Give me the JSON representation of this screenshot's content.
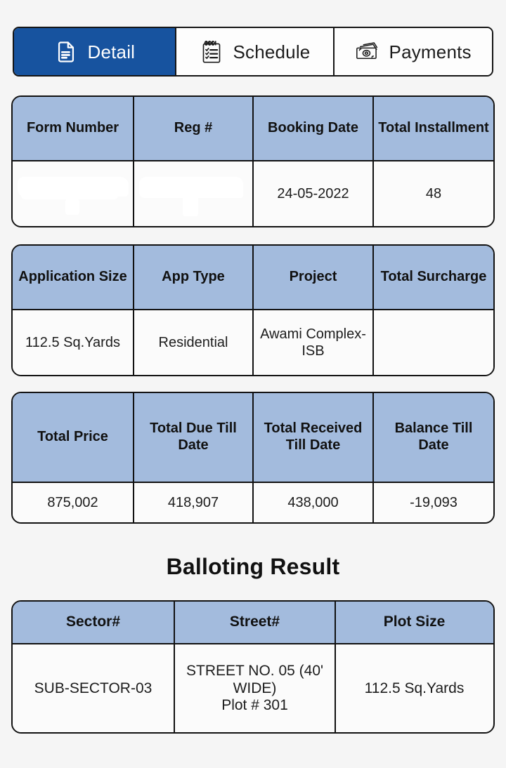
{
  "theme": {
    "page_background": "#f5f5f5",
    "active_tab_color": "#17539f",
    "table_header_color": "#a3bbdd",
    "border_color": "#111111",
    "text_color": "#1c1c1c"
  },
  "tabs": [
    {
      "id": "detail",
      "label": "Detail",
      "icon": "document-icon",
      "active": true
    },
    {
      "id": "schedule",
      "label": "Schedule",
      "icon": "checklist-clipboard-icon",
      "active": false
    },
    {
      "id": "payments",
      "label": "Payments",
      "icon": "banknotes-icon",
      "active": false
    }
  ],
  "tables": {
    "booking": {
      "headers": [
        "Form Number",
        "Reg #",
        "Booking Date",
        "Total Installment"
      ],
      "values": [
        "",
        "",
        "24-05-2022",
        "48"
      ],
      "redacted": [
        "Form Number",
        "Reg #"
      ]
    },
    "application": {
      "headers": [
        "Application Size",
        "App Type",
        "Project",
        "Total Surcharge"
      ],
      "values": [
        "112.5 Sq.Yards",
        "Residential",
        "Awami Complex-ISB",
        ""
      ]
    },
    "financial": {
      "headers": [
        "Total Price",
        "Total Due Till Date",
        "Total Received Till Date",
        "Balance Till Date"
      ],
      "values": [
        "875,002",
        "418,907",
        "438,000",
        "-19,093"
      ]
    },
    "balloting": {
      "title": "Balloting Result",
      "headers": [
        "Sector#",
        "Street#",
        "Plot Size"
      ],
      "values": [
        "SUB-SECTOR-03",
        "STREET NO. 05 (40' WIDE)\nPlot #  301",
        "112.5 Sq.Yards"
      ]
    }
  }
}
